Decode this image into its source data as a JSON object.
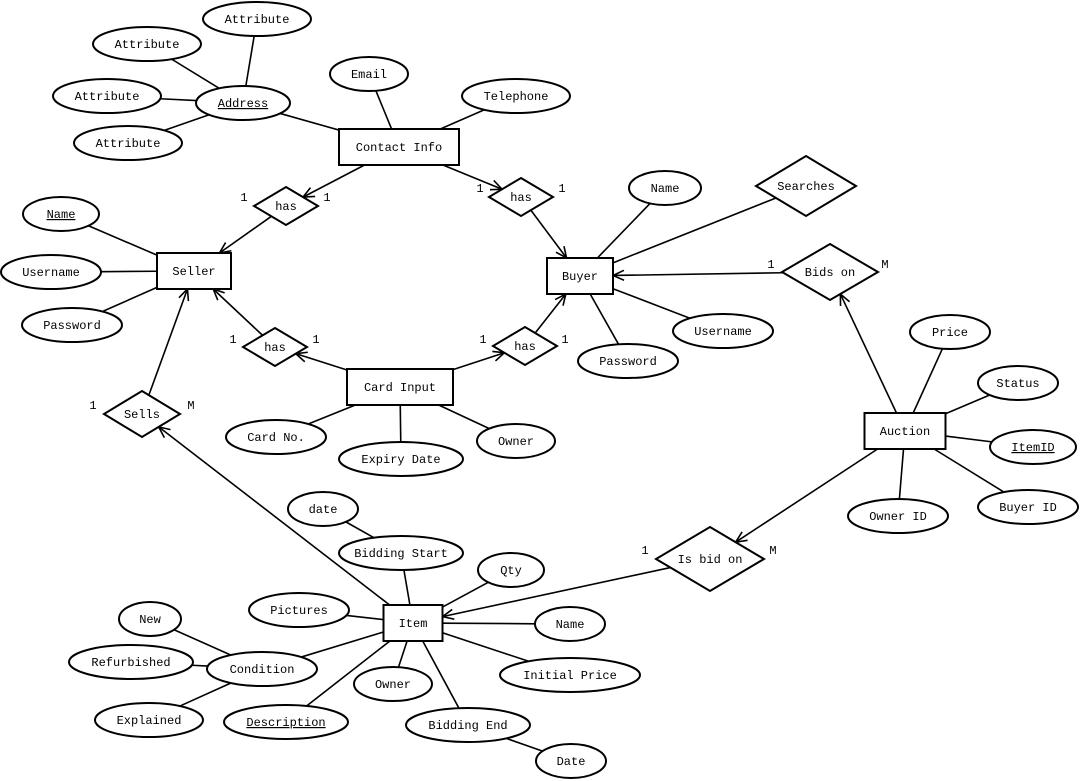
{
  "diagram": {
    "type": "er-diagram",
    "entities": [
      {
        "id": "contact",
        "label": "Contact Info"
      },
      {
        "id": "seller",
        "label": "Seller"
      },
      {
        "id": "buyer",
        "label": "Buyer"
      },
      {
        "id": "card",
        "label": "Card Input"
      },
      {
        "id": "auction",
        "label": "Auction"
      },
      {
        "id": "item",
        "label": "Item"
      }
    ],
    "relationships": [
      {
        "id": "has1",
        "label": "has"
      },
      {
        "id": "has2",
        "label": "has"
      },
      {
        "id": "has3",
        "label": "has"
      },
      {
        "id": "has4",
        "label": "has"
      },
      {
        "id": "bidson",
        "label": "Bids on"
      },
      {
        "id": "searches",
        "label": "Searches"
      },
      {
        "id": "sells",
        "label": "Sells"
      },
      {
        "id": "isbidon",
        "label": "Is bid on"
      }
    ],
    "attributes": [
      {
        "id": "a1",
        "label": "Attribute",
        "key": false
      },
      {
        "id": "a2",
        "label": "Attribute",
        "key": false
      },
      {
        "id": "a3",
        "label": "Attribute",
        "key": false
      },
      {
        "id": "address",
        "label": "Address",
        "key": true
      },
      {
        "id": "a4",
        "label": "Attribute",
        "key": false
      },
      {
        "id": "email",
        "label": "Email",
        "key": false
      },
      {
        "id": "tel",
        "label": "Telephone",
        "key": false
      },
      {
        "id": "sname",
        "label": "Name",
        "key": true
      },
      {
        "id": "suser",
        "label": "Username",
        "key": false
      },
      {
        "id": "spass",
        "label": "Password",
        "key": false
      },
      {
        "id": "bname",
        "label": "Name",
        "key": false
      },
      {
        "id": "buser",
        "label": "Username",
        "key": false
      },
      {
        "id": "bpass",
        "label": "Password",
        "key": false
      },
      {
        "id": "cardno",
        "label": "Card No.",
        "key": false
      },
      {
        "id": "expiry",
        "label": "Expiry Date",
        "key": false
      },
      {
        "id": "cowner",
        "label": "Owner",
        "key": false
      },
      {
        "id": "price",
        "label": "Price",
        "key": false
      },
      {
        "id": "status",
        "label": "Status",
        "key": false
      },
      {
        "id": "itemid",
        "label": "ItemID",
        "key": true
      },
      {
        "id": "ownerid",
        "label": "Owner ID",
        "key": false
      },
      {
        "id": "buyerid",
        "label": "Buyer ID",
        "key": false
      },
      {
        "id": "date1",
        "label": "date",
        "key": false
      },
      {
        "id": "bstart",
        "label": "Bidding Start",
        "key": false
      },
      {
        "id": "qty",
        "label": "Qty",
        "key": false
      },
      {
        "id": "pics",
        "label": "Pictures",
        "key": false
      },
      {
        "id": "iname",
        "label": "Name",
        "key": false
      },
      {
        "id": "iprice",
        "label": "Initial Price",
        "key": false
      },
      {
        "id": "new",
        "label": "New",
        "key": false
      },
      {
        "id": "refurb",
        "label": "Refurbished",
        "key": false
      },
      {
        "id": "cond",
        "label": "Condition",
        "key": false
      },
      {
        "id": "expl",
        "label": "Explained",
        "key": false
      },
      {
        "id": "iowner",
        "label": "Owner",
        "key": false
      },
      {
        "id": "desc",
        "label": "Description",
        "key": true
      },
      {
        "id": "bend",
        "label": "Bidding End",
        "key": false
      },
      {
        "id": "date2",
        "label": "Date",
        "key": false
      }
    ],
    "edges": [
      [
        "a1",
        "address",
        false
      ],
      [
        "a2",
        "address",
        false
      ],
      [
        "a3",
        "address",
        false
      ],
      [
        "a4",
        "address",
        false
      ],
      [
        "address",
        "contact",
        false
      ],
      [
        "email",
        "contact",
        false
      ],
      [
        "tel",
        "contact",
        false
      ],
      [
        "contact",
        "has1",
        true
      ],
      [
        "has1",
        "seller",
        true
      ],
      [
        "contact",
        "has2",
        true
      ],
      [
        "has2",
        "buyer",
        true
      ],
      [
        "has3",
        "seller",
        true
      ],
      [
        "card",
        "has3",
        true
      ],
      [
        "card",
        "has4",
        true
      ],
      [
        "has4",
        "buyer",
        true
      ],
      [
        "sname",
        "seller",
        false
      ],
      [
        "suser",
        "seller",
        false
      ],
      [
        "spass",
        "seller",
        false
      ],
      [
        "bname",
        "buyer",
        false
      ],
      [
        "buser",
        "buyer",
        false
      ],
      [
        "bpass",
        "buyer",
        false
      ],
      [
        "searches",
        "buyer",
        false
      ],
      [
        "cardno",
        "card",
        false
      ],
      [
        "expiry",
        "card",
        false
      ],
      [
        "cowner",
        "card",
        false
      ],
      [
        "bidson",
        "buyer",
        true
      ],
      [
        "auction",
        "bidson",
        true
      ],
      [
        "sells",
        "seller",
        true
      ],
      [
        "item",
        "sells",
        true
      ],
      [
        "auction",
        "isbidon",
        true
      ],
      [
        "isbidon",
        "item",
        true
      ],
      [
        "price",
        "auction",
        false
      ],
      [
        "status",
        "auction",
        false
      ],
      [
        "itemid",
        "auction",
        false
      ],
      [
        "ownerid",
        "auction",
        false
      ],
      [
        "buyerid",
        "auction",
        false
      ],
      [
        "date1",
        "bstart",
        false
      ],
      [
        "bstart",
        "item",
        false
      ],
      [
        "qty",
        "item",
        false
      ],
      [
        "pics",
        "item",
        false
      ],
      [
        "iname",
        "item",
        false
      ],
      [
        "iprice",
        "item",
        false
      ],
      [
        "cond",
        "item",
        false
      ],
      [
        "new",
        "cond",
        false
      ],
      [
        "refurb",
        "cond",
        false
      ],
      [
        "expl",
        "cond",
        false
      ],
      [
        "iowner",
        "item",
        false
      ],
      [
        "desc",
        "item",
        false
      ],
      [
        "bend",
        "item",
        false
      ],
      [
        "date2",
        "bend",
        false
      ]
    ],
    "cardinalities": [
      "1",
      "1",
      "1",
      "1",
      "1",
      "1",
      "1",
      "1",
      "1",
      "M",
      "1",
      "M",
      "1",
      "M"
    ]
  }
}
